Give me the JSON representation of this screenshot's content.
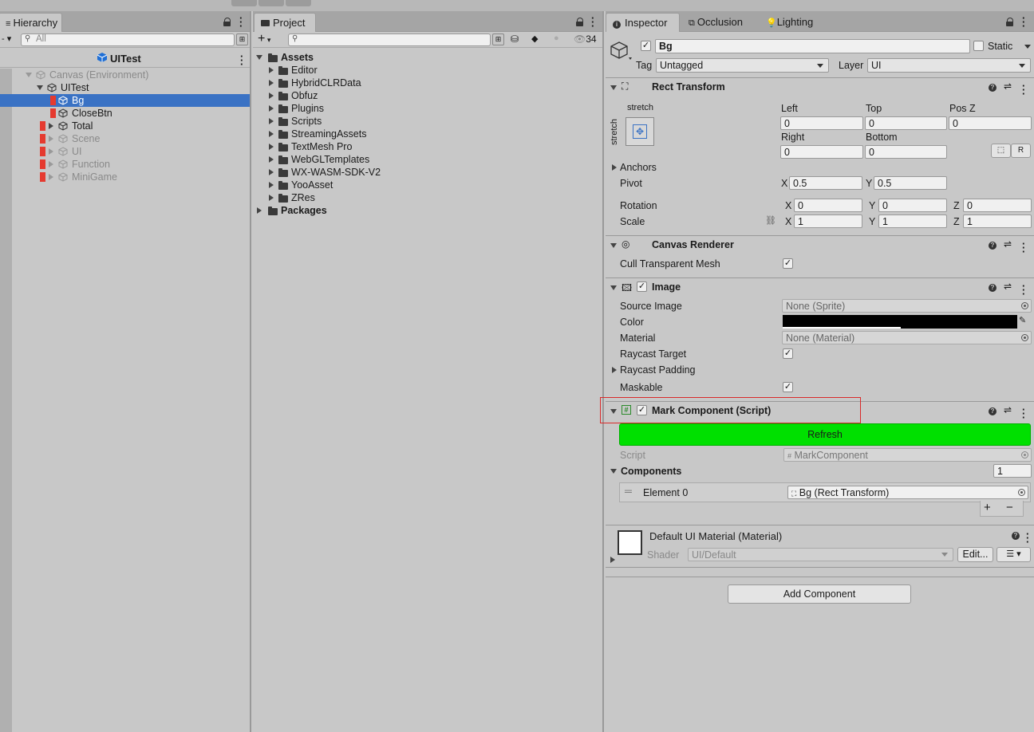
{
  "hierarchy": {
    "tab_label": "Hierarchy",
    "search_placeholder": "All",
    "scene_title": "UITest",
    "items": [
      {
        "label": "Canvas (Environment)"
      },
      {
        "label": "UITest"
      },
      {
        "label": "Bg"
      },
      {
        "label": "CloseBtn"
      },
      {
        "label": "Total"
      },
      {
        "label": "Scene"
      },
      {
        "label": "UI"
      },
      {
        "label": "Function"
      },
      {
        "label": "MiniGame"
      }
    ]
  },
  "project": {
    "tab_label": "Project",
    "add_label": "+",
    "hidden_count": "34",
    "tree": [
      {
        "label": "Assets"
      },
      {
        "label": "Editor"
      },
      {
        "label": "HybridCLRData"
      },
      {
        "label": "Obfuz"
      },
      {
        "label": "Plugins"
      },
      {
        "label": "Scripts"
      },
      {
        "label": "StreamingAssets"
      },
      {
        "label": "TextMesh Pro"
      },
      {
        "label": "WebGLTemplates"
      },
      {
        "label": "WX-WASM-SDK-V2"
      },
      {
        "label": "YooAsset"
      },
      {
        "label": "ZRes"
      },
      {
        "label": "Packages"
      }
    ]
  },
  "inspector": {
    "tabs": [
      {
        "label": "Inspector"
      },
      {
        "label": "Occlusion"
      },
      {
        "label": "Lighting"
      }
    ],
    "object_name": "Bg",
    "static_label": "Static",
    "tag_label": "Tag",
    "tag_value": "Untagged",
    "layer_label": "Layer",
    "layer_value": "UI",
    "rect_transform": {
      "title": "Rect Transform",
      "anchor_h": "stretch",
      "anchor_v": "stretch",
      "left_label": "Left",
      "left": "0",
      "top_label": "Top",
      "top": "0",
      "posz_label": "Pos Z",
      "posz": "0",
      "right_label": "Right",
      "right": "0",
      "bottom_label": "Bottom",
      "bottom": "0",
      "r_button": "R",
      "anchors_label": "Anchors",
      "pivot_label": "Pivot",
      "pivot_x": "0.5",
      "pivot_y": "0.5",
      "rotation_label": "Rotation",
      "rot_x": "0",
      "rot_y": "0",
      "rot_z": "0",
      "scale_label": "Scale",
      "scale_x": "1",
      "scale_y": "1",
      "scale_z": "1",
      "x": "X",
      "y": "Y",
      "z": "Z"
    },
    "canvas_renderer": {
      "title": "Canvas Renderer",
      "cull_label": "Cull Transparent Mesh"
    },
    "image": {
      "title": "Image",
      "source_label": "Source Image",
      "source_value": "None (Sprite)",
      "color_label": "Color",
      "color_value": "#000000",
      "material_label": "Material",
      "material_value": "None (Material)",
      "raycast_label": "Raycast Target",
      "padding_label": "Raycast Padding",
      "maskable_label": "Maskable"
    },
    "mark_component": {
      "title": "Mark Component (Script)",
      "refresh_label": "Refresh",
      "script_label": "Script",
      "script_value": "MarkComponent",
      "components_label": "Components",
      "components_count": "1",
      "element_label": "Element 0",
      "element_value": "Bg (Rect Transform)",
      "plus": "+",
      "minus": "−"
    },
    "material": {
      "title": "Default UI Material (Material)",
      "shader_label": "Shader",
      "shader_value": "UI/Default",
      "edit_label": "Edit..."
    },
    "add_component_label": "Add Component"
  },
  "colors": {
    "refresh_green": "#00e000",
    "selection_blue": "#3a72c4",
    "highlight_red": "#d92a2a",
    "bookmark_red": "#e53a2f"
  }
}
